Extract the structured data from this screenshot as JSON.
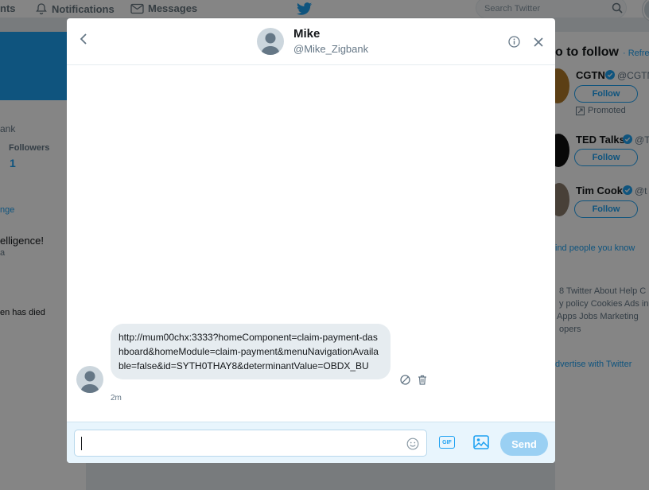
{
  "topbar": {
    "home_partial": "nts",
    "notifications": "Notifications",
    "messages": "Messages",
    "search_placeholder": "Search Twitter"
  },
  "left": {
    "name_partial": "ank",
    "followers_label": "Followers",
    "followers_count": "1",
    "link_partial": "nge",
    "tweet1_partial": "elligence!",
    "tweet1_sub_partial": "a",
    "tweet2_partial": "en has died"
  },
  "right": {
    "heading_partial": "o to follow",
    "refresh_partial": "· Refres",
    "suggestions": [
      {
        "name": "CGTN",
        "handle_partial": "@CGTN",
        "promoted": "Promoted",
        "follow": "Follow"
      },
      {
        "name": "TED Talks",
        "handle_partial": "@T",
        "follow": "Follow"
      },
      {
        "name": "Tim Cook",
        "handle_partial": "@t",
        "follow": "Follow"
      }
    ],
    "find_people": "ind people you know",
    "footer_lines": [
      "8 Twitter  About  Help C",
      "y policy  Cookies  Ads in",
      "  Apps  Jobs  Marketing",
      "opers"
    ],
    "advertise": "dvertise with Twitter"
  },
  "conversation": {
    "name": "Mike",
    "handle": "@Mike_Zigbank"
  },
  "message": {
    "text": "http://mum00chx:3333?homeComponent=claim-payment-dashboard&homeModule=claim-payment&menuNavigationAvailable=false&id=SYTH0THAY8&determinantValue=OBDX_BU",
    "time": "2m"
  },
  "composer": {
    "value": "",
    "placeholder": "",
    "gif_label": "GIF",
    "send_label": "Send"
  },
  "colors": {
    "brand": "#1da1f2",
    "send_disabled": "#9ad0f3"
  }
}
